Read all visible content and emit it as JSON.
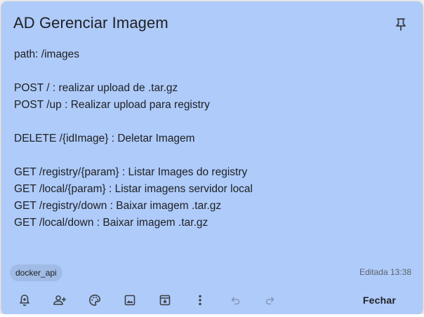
{
  "note": {
    "title": "AD Gerenciar Imagem",
    "background": "#aecbfa",
    "lines": [
      "path: /images",
      "",
      "POST / : realizar upload de .tar.gz",
      "POST /up : Realizar upload para registry",
      "",
      "DELETE /{idImage} : Deletar Imagem",
      "",
      "GET /registry/{param} : Listar Images do registry",
      "GET /local/{param} : Listar imagens servidor local",
      "GET /registry/down : Baixar imagem .tar.gz",
      "GET /local/down : Baixar imagem .tar.gz"
    ],
    "label": "docker_api",
    "edited": "Editada 13:38"
  },
  "toolbar": {
    "icons": [
      "bell-plus-icon",
      "person-add-icon",
      "palette-icon",
      "image-icon",
      "archive-icon",
      "more-vert-icon",
      "undo-icon",
      "redo-icon"
    ],
    "close_label": "Fechar"
  }
}
